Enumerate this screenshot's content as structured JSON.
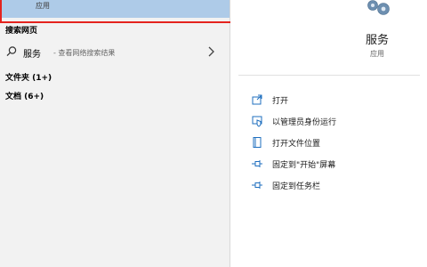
{
  "best_match": {
    "type": "应用"
  },
  "sections": {
    "web": "搜索网页",
    "folders": "文件夹 (1+)",
    "documents": "文档 (6+)"
  },
  "web_result": {
    "query": "服务",
    "hint": "- 查看网络搜索结果"
  },
  "app": {
    "name": "服务",
    "type": "应用"
  },
  "actions": [
    {
      "label": "打开",
      "icon": "open-icon"
    },
    {
      "label": "以管理员身份运行",
      "icon": "run-as-admin-icon"
    },
    {
      "label": "打开文件位置",
      "icon": "file-location-icon"
    },
    {
      "label": "固定到\"开始\"屏幕",
      "icon": "pin-icon"
    },
    {
      "label": "固定到任务栏",
      "icon": "pin-icon"
    }
  ],
  "colors": {
    "accent": "#1f6fbf",
    "selected": "#aecbe8",
    "highlight_box": "#e4231e"
  }
}
